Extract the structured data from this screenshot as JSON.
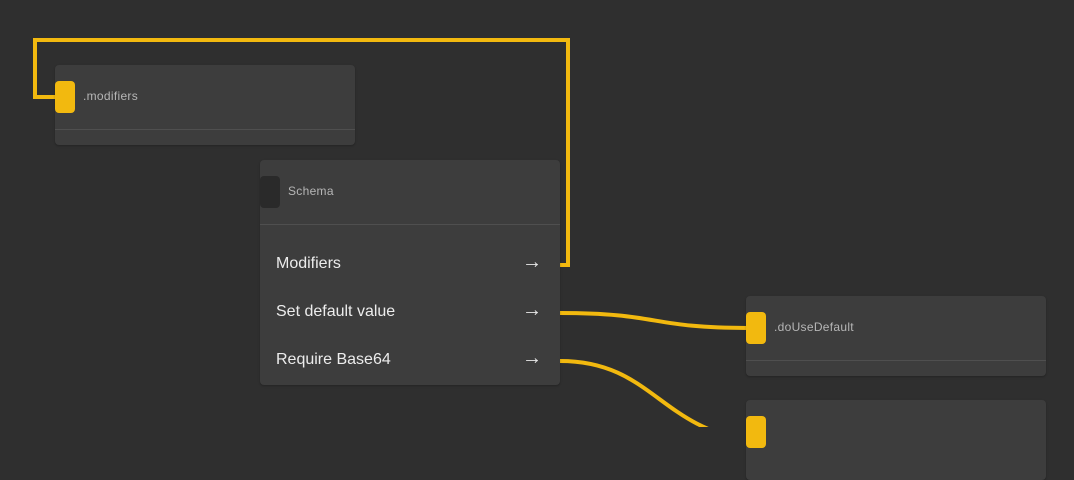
{
  "colors": {
    "background": "#2f2f2f",
    "node": "#3d3d3d",
    "wire": "#f2b90f",
    "port_active": "#f2b90f",
    "port_inactive": "#2a2a2a"
  },
  "nodes": {
    "modifiers": {
      "title": ".modifiers"
    },
    "schema": {
      "title": "Schema",
      "rows": [
        {
          "label": "Modifiers",
          "icon": "arrow-right-icon",
          "arrow": "→"
        },
        {
          "label": "Set default value",
          "icon": "arrow-right-icon",
          "arrow": "→"
        },
        {
          "label": "Require Base64",
          "icon": "arrow-right-icon",
          "arrow": "→"
        }
      ]
    },
    "do_use_default": {
      "title": ".doUseDefault"
    },
    "partial": {
      "title": ""
    }
  }
}
